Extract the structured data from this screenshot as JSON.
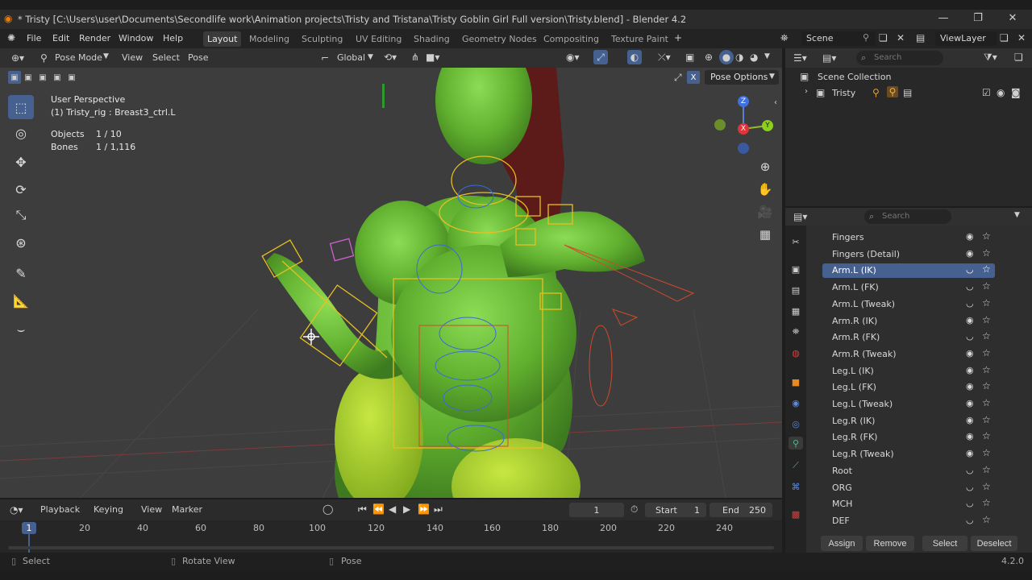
{
  "window": {
    "title": "* Tristy [C:\\Users\\user\\Documents\\Secondlife work\\Animation projects\\Tristy and Tristana\\Tristy Goblin Girl Full version\\Tristy.blend] - Blender 4.2"
  },
  "menu": [
    "File",
    "Edit",
    "Render",
    "Window",
    "Help"
  ],
  "workspaces": [
    {
      "label": "Layout",
      "active": true
    },
    {
      "label": "Modeling"
    },
    {
      "label": "Sculpting"
    },
    {
      "label": "UV Editing"
    },
    {
      "label": "Shading"
    },
    {
      "label": "Geometry Nodes"
    },
    {
      "label": "Compositing"
    },
    {
      "label": "Texture Paint"
    }
  ],
  "scene": {
    "label": "Scene",
    "viewlayer": "ViewLayer"
  },
  "viewport_header": {
    "mode": "Pose Mode",
    "view": "View",
    "select": "Select",
    "pose": "Pose",
    "orientation": "Global",
    "pose_options": "Pose Options"
  },
  "overlay": {
    "perspective": "User Perspective",
    "active": "(1) Tristy_rig : Breast3_ctrl.L",
    "objects_label": "Objects",
    "objects_value": "1 / 10",
    "bones_label": "Bones",
    "bones_value": "1 / 1,116"
  },
  "gizmo": {
    "z": "Z",
    "x": "X",
    "y": "Y"
  },
  "outliner": {
    "search_placeholder": "Search",
    "root": "Scene Collection",
    "items": [
      {
        "label": "Tristy"
      }
    ]
  },
  "properties": {
    "search_placeholder": "Search",
    "collections": [
      {
        "label": "Fingers",
        "visible": true
      },
      {
        "label": "Fingers (Detail)",
        "visible": true
      },
      {
        "label": "Arm.L (IK)",
        "visible": false,
        "selected": true
      },
      {
        "label": "Arm.L (FK)",
        "visible": false
      },
      {
        "label": "Arm.L (Tweak)",
        "visible": false
      },
      {
        "label": "Arm.R (IK)",
        "visible": true
      },
      {
        "label": "Arm.R (FK)",
        "visible": false
      },
      {
        "label": "Arm.R (Tweak)",
        "visible": true
      },
      {
        "label": "Leg.L (IK)",
        "visible": true
      },
      {
        "label": "Leg.L (FK)",
        "visible": true
      },
      {
        "label": "Leg.L (Tweak)",
        "visible": true
      },
      {
        "label": "Leg.R (IK)",
        "visible": true
      },
      {
        "label": "Leg.R (FK)",
        "visible": true
      },
      {
        "label": "Leg.R (Tweak)",
        "visible": true
      },
      {
        "label": "Root",
        "visible": false
      },
      {
        "label": "ORG",
        "visible": false
      },
      {
        "label": "MCH",
        "visible": false
      },
      {
        "label": "DEF",
        "visible": false
      }
    ],
    "buttons": {
      "assign": "Assign",
      "remove": "Remove",
      "select": "Select",
      "deselect": "Deselect"
    }
  },
  "timeline": {
    "menus": {
      "playback": "Playback",
      "keying": "Keying",
      "view": "View",
      "marker": "Marker"
    },
    "current_frame": "1",
    "start_label": "Start",
    "start_value": "1",
    "end_label": "End",
    "end_value": "250",
    "ticks": [
      "1",
      "20",
      "40",
      "60",
      "80",
      "100",
      "120",
      "140",
      "160",
      "180",
      "200",
      "220",
      "240"
    ]
  },
  "status": {
    "select": "Select",
    "rotate": "Rotate View",
    "pose": "Pose",
    "version": "4.2.0"
  }
}
